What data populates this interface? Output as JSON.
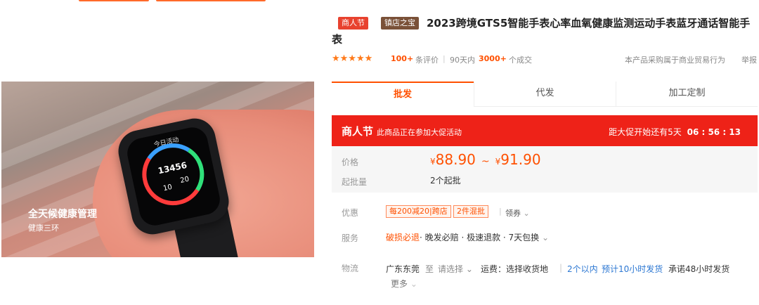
{
  "product": {
    "badges": [
      "商人节",
      "镇店之宝"
    ],
    "title": "2023跨境GTS5智能手表心率血氧健康监测运动手表蓝牙通话智能手表",
    "stars": "★★★★★",
    "review_count": "100+",
    "review_label": "条评价",
    "sold_prefix": "90天内",
    "sold_count": "3000+",
    "sold_suffix": "个成交",
    "notice": "本产品采购属于商业贸易行为",
    "report": "举报"
  },
  "hero": {
    "caption": "全天候健康管理",
    "subcaption": "健康三环",
    "watch_steps": "13456",
    "watch_label_top": "今日活动",
    "watch_left": "10",
    "watch_right": "20"
  },
  "tabs": [
    {
      "label": "批发",
      "active": true
    },
    {
      "label": "代发",
      "active": false
    },
    {
      "label": "加工定制",
      "active": false
    }
  ],
  "promo": {
    "name": "商人节",
    "desc": "此商品正在参加大促活动",
    "countdown_label": "距大促开始还有5天",
    "countdown_time": "06 : 56 : 13"
  },
  "pricing": {
    "price_label": "价格",
    "currency": "¥",
    "price_min": "88.90",
    "price_max": "91.90",
    "tilde": "~",
    "min_label": "起批量",
    "min_value": "2个起批"
  },
  "offers": {
    "label": "优惠",
    "coupons": [
      "每200减20|跨店",
      "2件混批"
    ],
    "coupon_link": "领券"
  },
  "service": {
    "label": "服务",
    "highlight": "破损必退",
    "items": "· 晚发必赔 · 极速退款 · 7天包换"
  },
  "logistics": {
    "label": "物流",
    "origin": "广东东莞",
    "to": "至",
    "destination": "请选择",
    "fee": "运费：选择收货地",
    "stock": "2个以内",
    "ship_time": "预计10小时发货",
    "promise": "承诺48小时发货",
    "more": "更多"
  },
  "colors": {
    "accent": "#ff5000",
    "promo_bg": "#ee2218",
    "link": "#2a76d2"
  }
}
